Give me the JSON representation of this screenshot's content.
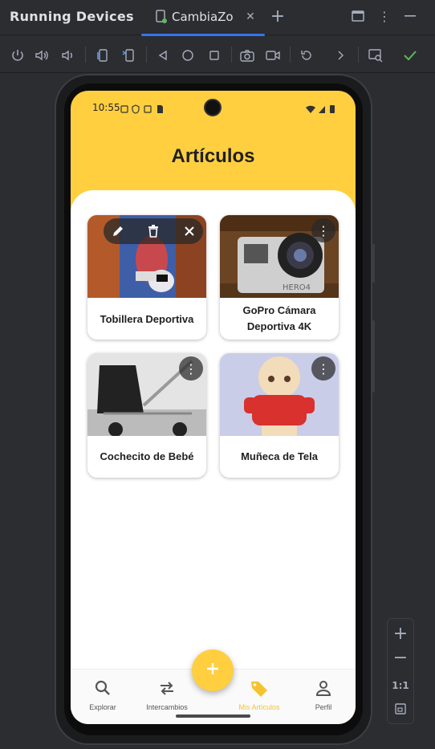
{
  "ide": {
    "title": "Running Devices",
    "tab_label": "CambiaZo",
    "zoom_ratio": "1:1"
  },
  "device": {
    "time": "10:55"
  },
  "app": {
    "title": "Artículos",
    "items": [
      {
        "name": "Tobillera Deportiva"
      },
      {
        "name": "GoPro Cámara Deportiva 4K"
      },
      {
        "name": "Cochecito de Bebé"
      },
      {
        "name": "Muñeca de Tela"
      }
    ],
    "nav": [
      {
        "label": "Explorar",
        "icon": "search-icon"
      },
      {
        "label": "Intercambios",
        "icon": "swap-icon"
      },
      {
        "label": "Mis Artículos",
        "icon": "tag-icon"
      },
      {
        "label": "Perfil",
        "icon": "person-icon"
      }
    ],
    "accent_color": "#ffcf40"
  }
}
